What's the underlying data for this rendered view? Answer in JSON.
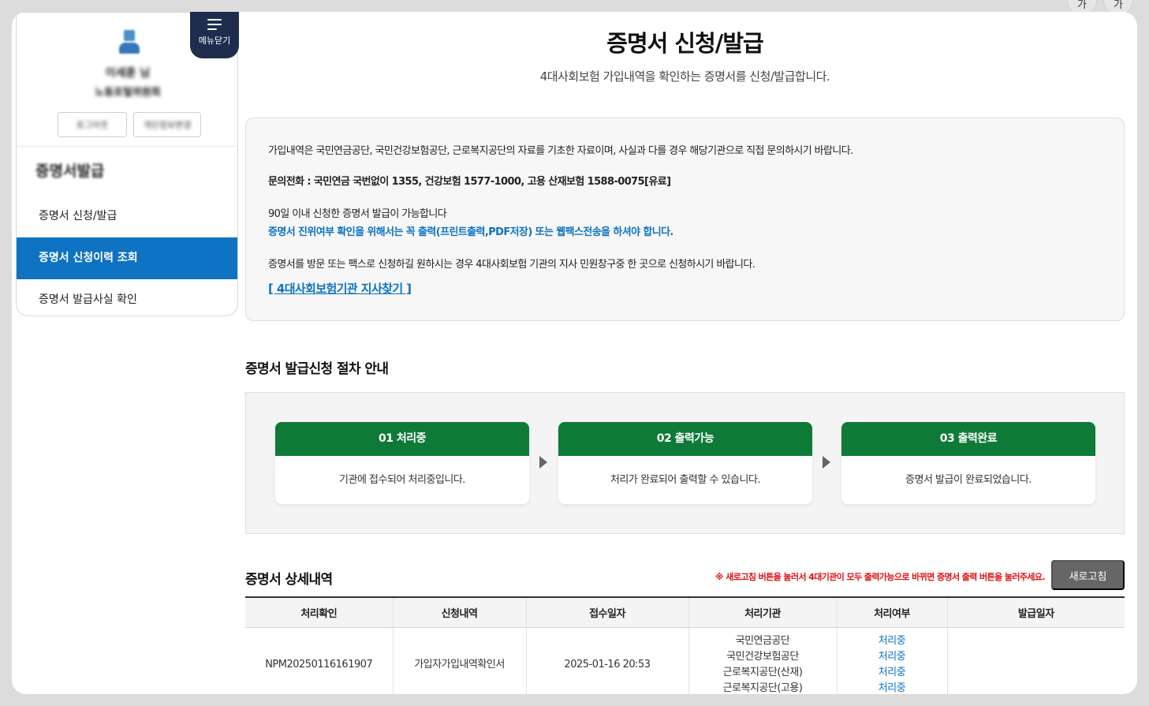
{
  "font_buttons": [
    "가",
    "가"
  ],
  "menu_toggle": {
    "label": "메뉴닫기"
  },
  "profile": {
    "name": "이세훈 님",
    "org": "노동포털위원회",
    "buttons": [
      "로그아웃",
      "개인정보변경"
    ]
  },
  "sidebar": {
    "title": "증명서발급",
    "items": [
      {
        "label": "증명서 신청/발급",
        "active": false
      },
      {
        "label": "증명서 신청이력 조회",
        "active": true
      },
      {
        "label": "증명서 발급사실 확인",
        "active": false
      }
    ]
  },
  "page": {
    "title": "증명서 신청/발급",
    "subtitle": "4대사회보험 가입내역을 확인하는 증명서를 신청/발급합니다."
  },
  "notice": {
    "line1": "가입내역은 국민연금공단, 국민건강보험공단, 근로복지공단의 자료를 기초한 자료이며, 사실과 다를 경우 해당기관으로 직접 문의하시기 바랍니다.",
    "line2": "문의전화 : 국민연금 국번없이 1355, 건강보험 1577-1000, 고용 산재보험 1588-0075[유료]",
    "line3": "90일 이내 신청한 증명서 발급이 가능합니다",
    "line4": "증명서 진위여부 확인을 위해서는 꼭 출력(프린트출력,PDF저장) 또는 웹팩스전송을 하셔야 합니다.",
    "line5": "증명서를 방문 또는 팩스로 신청하길 원하시는 경우 4대사회보험 기관의 지사 민원창구중 한 곳으로 신청하시기 바랍니다.",
    "link": "[ 4대사회보험기관 지사찾기 ]"
  },
  "steps_section": {
    "title": "증명서 발급신청 절차 안내",
    "steps": [
      {
        "title": "01 처리중",
        "desc": "기관에 접수되어 처리중입니다."
      },
      {
        "title": "02 출력가능",
        "desc": "처리가 완료되어 출력할 수 있습니다."
      },
      {
        "title": "03 출력완료",
        "desc": "증명서 발급이 완료되었습니다."
      }
    ]
  },
  "detail": {
    "title": "증명서 상세내역",
    "warning": "※ 새로고침 버튼을 눌러서 4대기관이 모두 출력가능으로 바뀌면 증명서 출력 버튼을 눌러주세요.",
    "refresh_label": "새로고침",
    "columns": [
      "처리확인",
      "신청내역",
      "접수일자",
      "처리기관",
      "처리여부",
      "발급일자"
    ],
    "rows": [
      {
        "id": "NPM20250116161907",
        "type": "가입자가입내역확인서",
        "date": "2025-01-16 20:53",
        "agencies": [
          "국민연금공단",
          "국민건강보험공단",
          "근로복지공단(산재)",
          "근로복지공단(고용)"
        ],
        "statuses": [
          "처리중",
          "처리중",
          "처리중",
          "처리중"
        ],
        "issue_date": ""
      }
    ]
  },
  "colors": {
    "accent_blue": "#0d73c2",
    "step_green": "#0e7a37",
    "menu_navy": "#1e2d4e"
  }
}
